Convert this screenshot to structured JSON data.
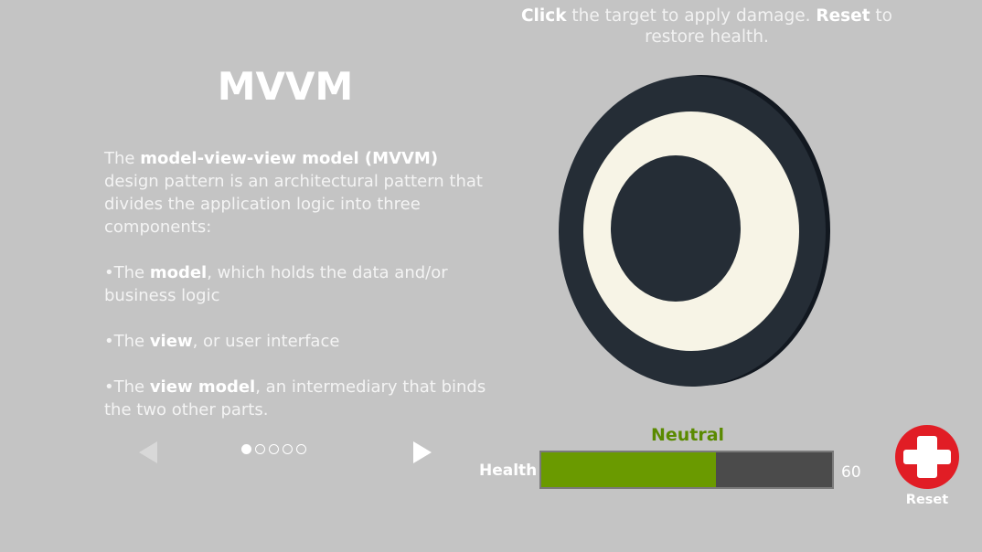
{
  "instructions": {
    "click_word": "Click",
    "part1": " the target to apply damage. ",
    "reset_word": "Reset",
    "part2": " to restore health."
  },
  "panel": {
    "title": "MVVM",
    "intro_pre": "The ",
    "intro_bold": "model-view-view model (MVVM)",
    "intro_post": " design pattern is an architectural pattern that divides the application logic into three components:",
    "item1_pre": "•The ",
    "item1_bold": "model",
    "item1_post": ", which holds the data and/or business logic",
    "item2_pre": "•The ",
    "item2_bold": "view",
    "item2_post": ", or user interface",
    "item3_pre": "•The ",
    "item3_bold": "view model",
    "item3_post": ", an intermediary that binds the two other parts."
  },
  "pager": {
    "total_pages": 5,
    "current_page": 1
  },
  "icons": {
    "prev": "chevron-left-icon",
    "next": "chevron-right-icon",
    "reset": "medical-cross-icon",
    "target": "target-icon"
  },
  "status": {
    "label": "Neutral",
    "color": "#5a8a00"
  },
  "health": {
    "label": "Health",
    "value": "60",
    "max": 100,
    "fill_color": "#6a9a00",
    "track_color": "#4b4b4b"
  },
  "reset": {
    "label": "Reset",
    "color": "#e11d25"
  },
  "colors": {
    "background": "#c4c4c4",
    "target_dark": "#252d36",
    "target_ring": "#f7f4e6"
  }
}
